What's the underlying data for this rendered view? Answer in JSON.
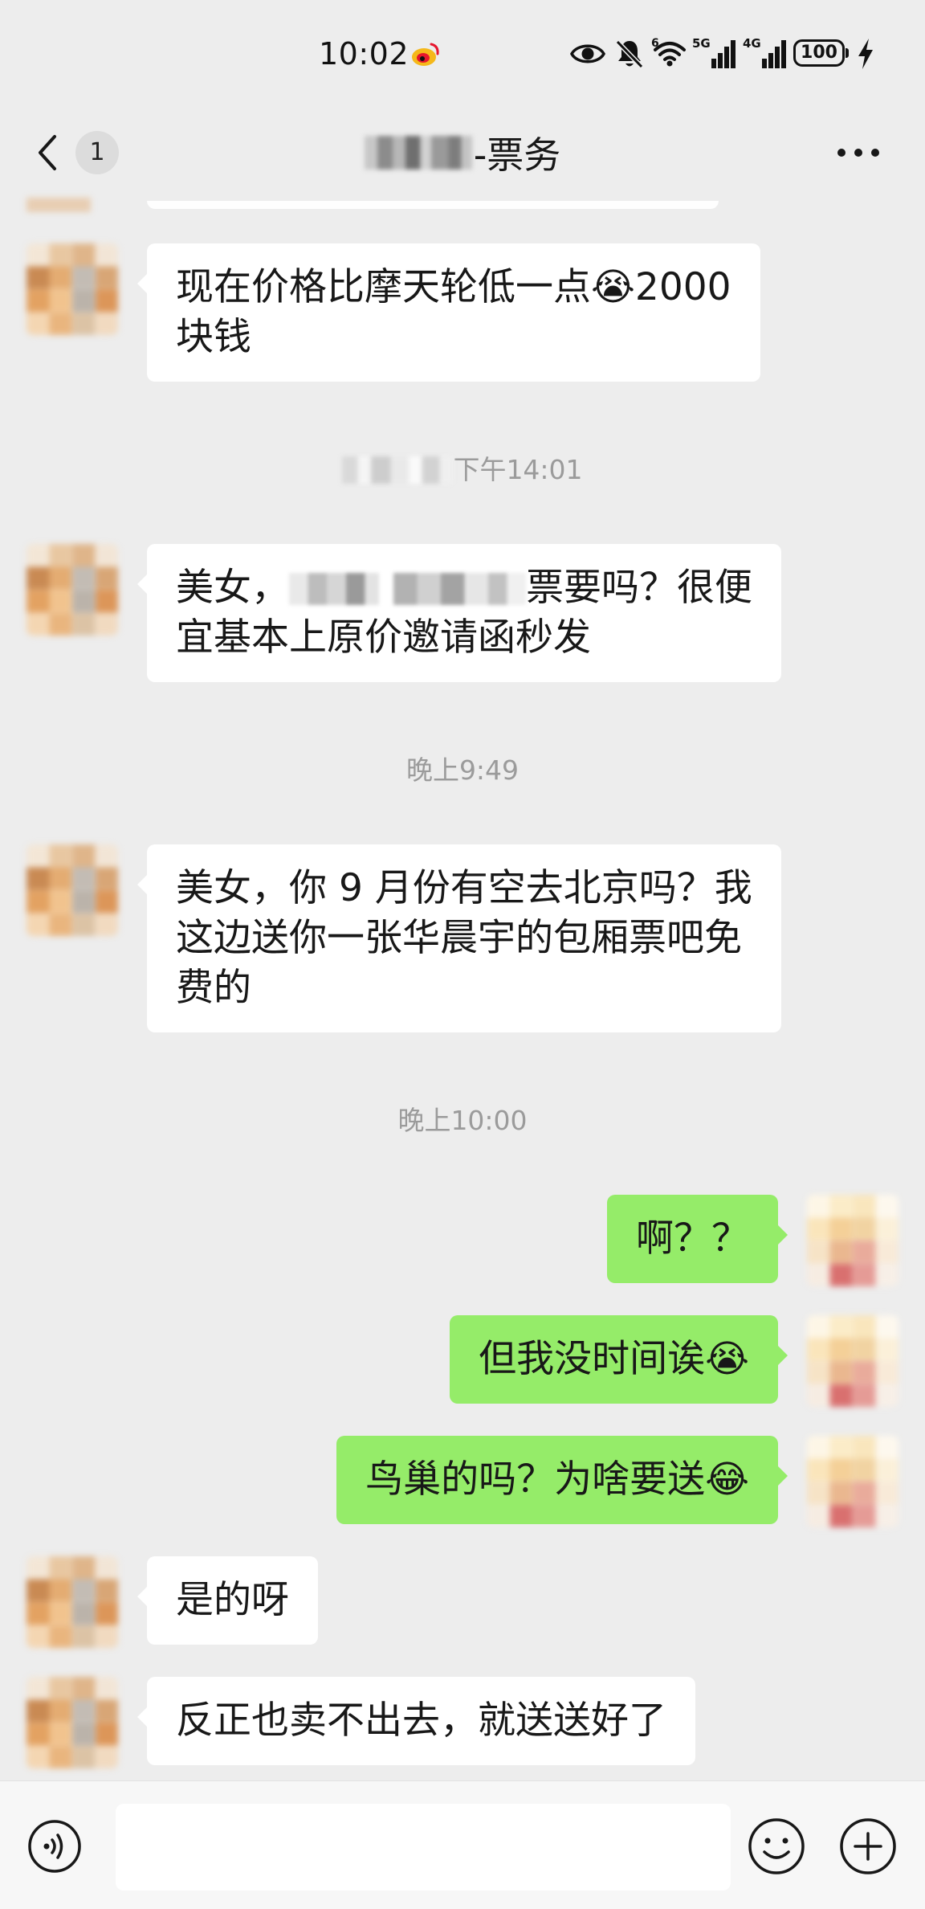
{
  "status_bar": {
    "time": "10:02",
    "wifi_label": "6",
    "network_1": "5G",
    "network_2": "4G",
    "battery": "100",
    "icons": [
      "weibo-icon",
      "eye-icon",
      "bell-muted-icon",
      "wifi-icon",
      "signal-5g-icon",
      "signal-4g-icon",
      "battery-icon",
      "charging-icon"
    ]
  },
  "header": {
    "back_badge": "1",
    "title": {
      "redacted": true,
      "suffix": "-票务"
    },
    "icons": [
      "back-chevron-icon",
      "more-icon"
    ]
  },
  "colors": {
    "background": "#ededed",
    "incoming_bubble": "#ffffff",
    "outgoing_bubble": "#95ec69",
    "timestamp": "#9b9b9b",
    "text": "#181818"
  },
  "messages": [
    {
      "incoming": {
        "lines": [
          [
            "现在价格比摩天轮低一点😭2000"
          ],
          [
            "块钱"
          ]
        ]
      }
    },
    {
      "timestamp": "下午14:01",
      "redacted": true
    },
    {
      "incoming": {
        "redacted": true,
        "lines": [
          [
            "美女，",
            "票要吗？很便"
          ],
          [
            "宜基本上原价邀请函秒发"
          ]
        ]
      }
    },
    {
      "timestamp": "晚上9:49"
    },
    {
      "incoming": {
        "lines": [
          [
            "美女，你 9 月份有空去北京吗？我"
          ],
          [
            "这边送你一张华晨宇的包厢票吧免"
          ],
          [
            "费的"
          ]
        ]
      }
    },
    {
      "timestamp": "晚上10:00"
    },
    {
      "outgoing": {
        "lines": [
          [
            "啊？？"
          ]
        ]
      }
    },
    {
      "outgoing": {
        "lines": [
          [
            "但我没时间诶😭"
          ]
        ]
      }
    },
    {
      "outgoing": {
        "lines": [
          [
            "鸟巢的吗？为啥要送😂"
          ]
        ]
      }
    },
    {
      "incoming": {
        "lines": [
          [
            "是的呀"
          ]
        ]
      }
    },
    {
      "incoming": {
        "lines": [
          [
            "反正也卖不出去，就送送好了"
          ]
        ]
      }
    }
  ],
  "bottom_bar": {
    "icons": [
      "voice-icon",
      "emoji-icon",
      "plus-icon"
    ]
  }
}
